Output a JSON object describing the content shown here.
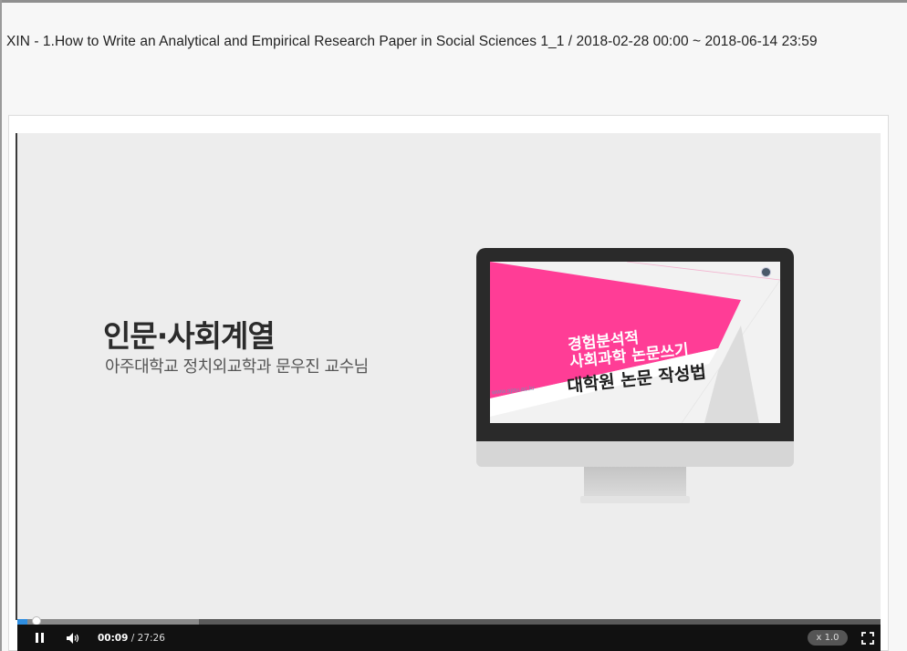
{
  "page": {
    "title": "XIN - 1.How to Write an Analytical and Empirical Research Paper in Social Sciences 1_1 / 2018-02-28 00:00 ~ 2018-06-14 23:59"
  },
  "video": {
    "headline": "인문·사회계열",
    "subline": "아주대학교 정치외교학과 문우진 교수님",
    "screen": {
      "title_line1": "경험분석적",
      "title_line2": "사회과학 논문쓰기",
      "title_line3": "대학원 논문 작성법",
      "url": "www.ajou.ac.kr"
    },
    "colors": {
      "accent_pink": "#ff3d96",
      "progress": "#2f8ee0"
    }
  },
  "controls": {
    "current_time": "00:09",
    "separator": " / ",
    "duration": "27:26",
    "speed": "x 1.0",
    "played_fraction": 0.012,
    "buffered_fraction": 0.21,
    "icons": [
      "pause-icon",
      "volume-icon",
      "fullscreen-icon"
    ]
  }
}
